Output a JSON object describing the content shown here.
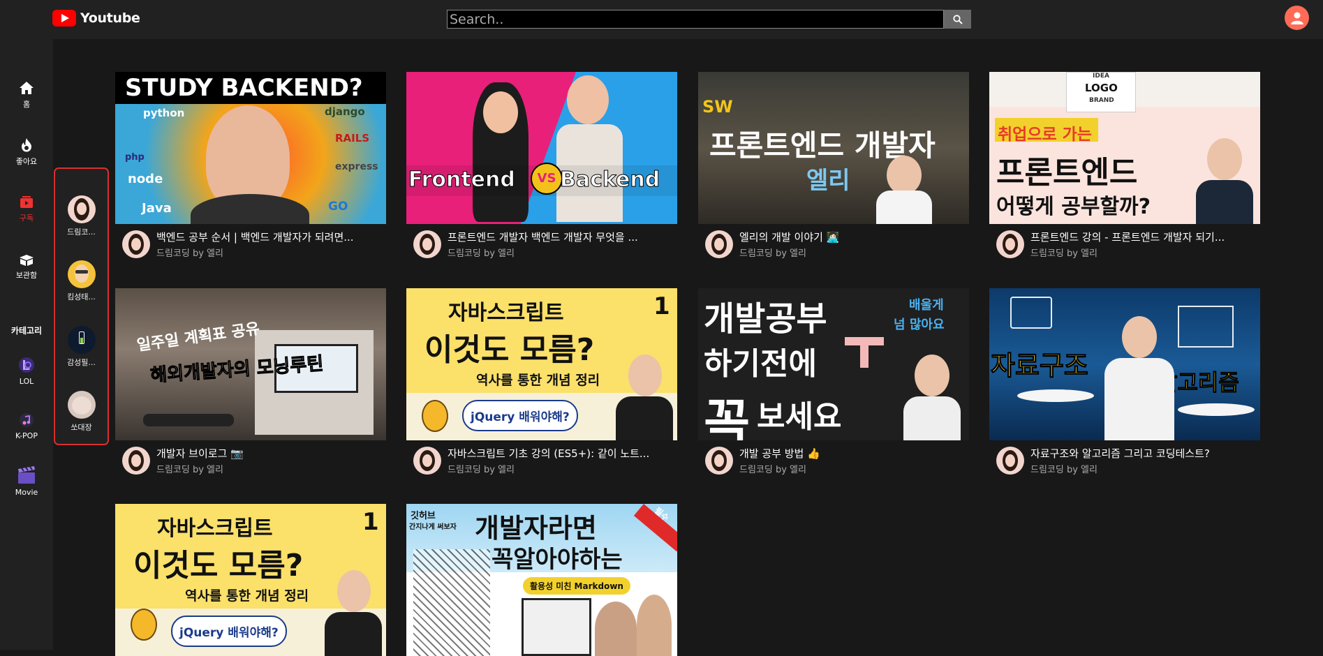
{
  "header": {
    "logo_text": "Youtube",
    "search_placeholder": "Search..",
    "icons": [
      "youtube-logo-icon",
      "search-icon",
      "user-icon"
    ],
    "colors": {
      "brand": "#ff0000",
      "avatar": "#ff6b57",
      "active": "#e33333",
      "border": "#d9302e"
    }
  },
  "sidebar": {
    "items": [
      {
        "label": "홈",
        "icon": "home-icon"
      },
      {
        "label": "좋아요",
        "icon": "fire-icon"
      },
      {
        "label": "구독",
        "icon": "subscriptions-icon",
        "active": true
      },
      {
        "label": "보관함",
        "icon": "library-icon"
      }
    ],
    "category_label": "카테고리",
    "categories": [
      {
        "label": "LOL",
        "icon": "lol-icon"
      },
      {
        "label": "K-POP",
        "icon": "music-icon"
      },
      {
        "label": "Movie",
        "icon": "clapperboard-icon"
      }
    ]
  },
  "subscriptions": [
    {
      "name": "드림코..."
    },
    {
      "name": "킴성태..."
    },
    {
      "name": "감성필..."
    },
    {
      "name": "쏘대장"
    }
  ],
  "videos": [
    {
      "title": "백엔드 공부 순서 | 백엔드 개발자가 되려면...",
      "channel": "드림코딩 by 엘리",
      "thumb_main": "STUDY BACKEND?",
      "thumb_words": [
        "python",
        "django",
        "RAILS",
        "php",
        "node",
        "express",
        "Java",
        "GO"
      ]
    },
    {
      "title": "프론트엔드 개발자 백엔드 개발자 무엇을 ...",
      "channel": "드림코딩 by 엘리",
      "thumb_left": "Frontend",
      "thumb_vs": "VS",
      "thumb_right": "Backend"
    },
    {
      "title": "엘리의 개발 이야기 👩🏻‍💻",
      "channel": "드림코딩 by 엘리",
      "thumb_tag": "SW",
      "thumb_main": "프론트엔드 개발자",
      "thumb_sub": "엘리"
    },
    {
      "title": "프론트엔드 강의 - 프론트엔드 개발자 되기...",
      "channel": "드림코딩 by 엘리",
      "thumb_top": "취업으로 가는",
      "thumb_main": "프론트엔드",
      "thumb_sub": "어떻게 공부할까?",
      "thumb_board": [
        "IDEA",
        "LOGO",
        "BRAND"
      ]
    },
    {
      "title": "개발자 브이로그 📷",
      "channel": "드림코딩 by 엘리",
      "thumb_top": "일주일 계획표 공유",
      "thumb_main": "해외개발자의 모닝루틴"
    },
    {
      "title": "자바스크립트 기초 강의 (ES5+): 같이 노트...",
      "channel": "드림코딩 by 엘리",
      "thumb_top": "자바스크립트",
      "thumb_main": "이것도 모름?",
      "thumb_sub": "역사를 통한 개념 정리",
      "thumb_num": "1",
      "thumb_badge": "jQuery 배워야해?"
    },
    {
      "title": "개발 공부 방법 👍",
      "channel": "드림코딩 by 엘리",
      "thumb_l1": "개발공부",
      "thumb_l2": "하기전에",
      "thumb_big": "꼭",
      "thumb_l3": "보세요",
      "thumb_side": [
        "배울게",
        "넘 많아요"
      ]
    },
    {
      "title": "자료구조와 알고리즘 그리고 코딩테스트?",
      "channel": "드림코딩 by 엘리",
      "thumb_left": "자료구조",
      "thumb_right": "알고리즘"
    },
    {
      "title": "",
      "channel": "",
      "thumb_top": "자바스크립트",
      "thumb_main": "이것도 모름?",
      "thumb_sub": "역사를 통한 개념 정리",
      "thumb_num": "1",
      "thumb_badge": "jQuery 배워야해?"
    },
    {
      "title": "",
      "channel": "",
      "thumb_tag": "깃허브",
      "thumb_tag2": "간지나게 써보자",
      "thumb_main": "개발자라면",
      "thumb_sub": "꼭알아야하는",
      "thumb_badge": "활용성 미친 Markdown",
      "thumb_corner": "필수"
    }
  ]
}
